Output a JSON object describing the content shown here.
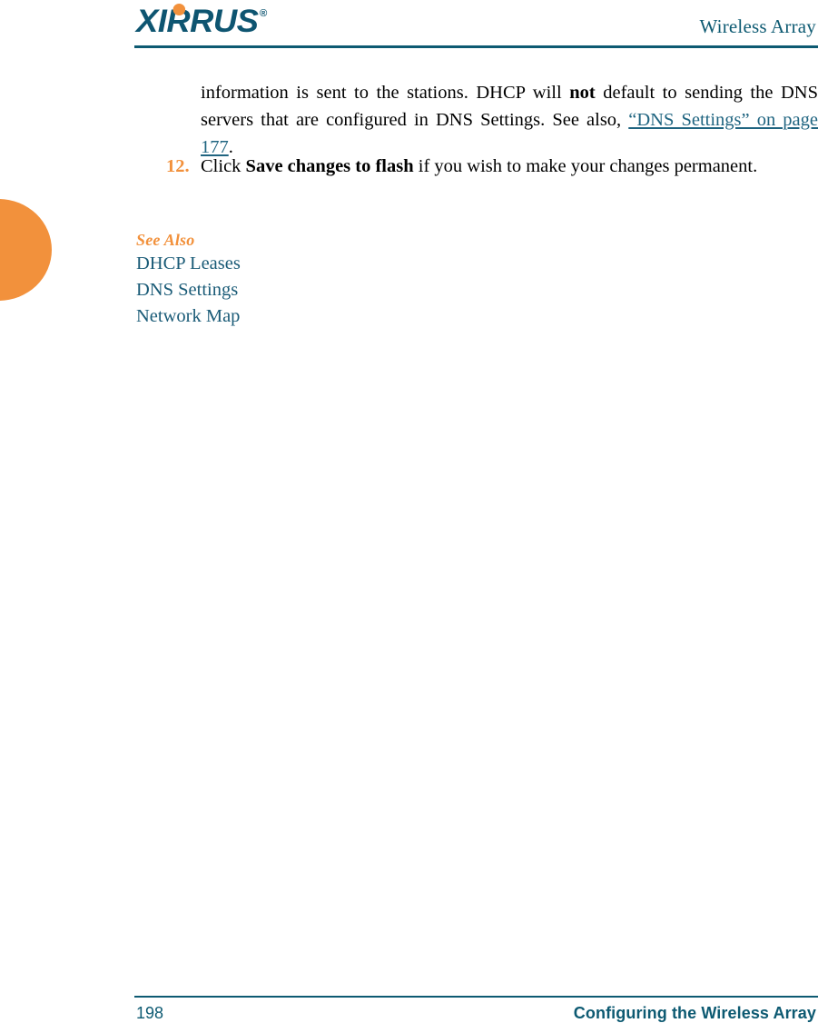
{
  "header": {
    "logo_text": "XIRRUS",
    "logo_registered_mark": "®",
    "title": "Wireless Array"
  },
  "content": {
    "paragraph": {
      "part1": "information is sent to the stations. DHCP will ",
      "bold1": "not",
      "part2": " default to sending the DNS servers that are configured in DNS Settings. See also, ",
      "link1": "“DNS Settings” on page 177",
      "part3": "."
    },
    "list_item": {
      "number": "12.",
      "part1": "Click ",
      "bold1": "Save changes to flash",
      "part2": " if you wish to make your changes permanent."
    },
    "see_also": {
      "heading": "See Also",
      "links": [
        "DHCP Leases",
        "DNS Settings",
        "Network Map"
      ]
    }
  },
  "footer": {
    "page_number": "198",
    "section_title": "Configuring the Wireless Array"
  },
  "colors": {
    "teal": "#0D5A72",
    "link_teal": "#1F6480",
    "orange": "#F2913C",
    "body_text": "#000000"
  }
}
